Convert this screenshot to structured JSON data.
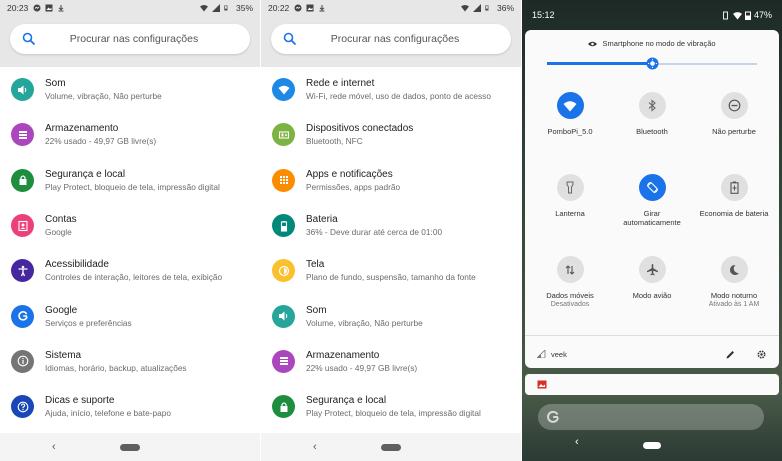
{
  "left_panel": {
    "status": {
      "time": "20:23",
      "battery": "35%"
    },
    "search_placeholder": "Procurar nas configurações",
    "items": [
      {
        "title": "Som",
        "subtitle": "Volume, vibração, Não perturbe",
        "icon": "volume-icon",
        "color": "#26a69a"
      },
      {
        "title": "Armazenamento",
        "subtitle": "22% usado - 49,97 GB livre(s)",
        "icon": "storage-icon",
        "color": "#ab47bc"
      },
      {
        "title": "Segurança e local",
        "subtitle": "Play Protect, bloqueio de tela, impressão digital",
        "icon": "lock-icon",
        "color": "#1e8e3e"
      },
      {
        "title": "Contas",
        "subtitle": "Google",
        "icon": "account-icon",
        "color": "#ec407a"
      },
      {
        "title": "Acessibilidade",
        "subtitle": "Controles de interação, leitores de tela, exibição",
        "icon": "accessibility-icon",
        "color": "#4527a0"
      },
      {
        "title": "Google",
        "subtitle": "Serviços e preferências",
        "icon": "google-icon",
        "color": "#1a73e8"
      },
      {
        "title": "Sistema",
        "subtitle": "Idiomas, horário, backup, atualizações",
        "icon": "info-icon",
        "color": "#757575"
      },
      {
        "title": "Dicas e suporte",
        "subtitle": "Ajuda, início, telefone e bate-papo",
        "icon": "help-icon",
        "color": "#1a47b8"
      }
    ]
  },
  "middle_panel": {
    "status": {
      "time": "20:22",
      "battery": "36%"
    },
    "search_placeholder": "Procurar nas configurações",
    "items": [
      {
        "title": "Rede e internet",
        "subtitle": "Wi-Fi, rede móvel, uso de dados, ponto de acesso",
        "icon": "wifi-icon",
        "color": "#1e88e5"
      },
      {
        "title": "Dispositivos conectados",
        "subtitle": "Bluetooth, NFC",
        "icon": "devices-icon",
        "color": "#7cb342"
      },
      {
        "title": "Apps e notificações",
        "subtitle": "Permissões, apps padrão",
        "icon": "apps-icon",
        "color": "#fb8c00"
      },
      {
        "title": "Bateria",
        "subtitle": "36% - Deve durar até cerca de 01:00",
        "icon": "battery-icon",
        "color": "#00897b"
      },
      {
        "title": "Tela",
        "subtitle": "Plano de fundo, suspensão, tamanho da fonte",
        "icon": "brightness-icon",
        "color": "#fbc02d"
      },
      {
        "title": "Som",
        "subtitle": "Volume, vibração, Não perturbe",
        "icon": "volume-icon",
        "color": "#26a69a"
      },
      {
        "title": "Armazenamento",
        "subtitle": "22% usado - 49,97 GB livre(s)",
        "icon": "storage-icon",
        "color": "#ab47bc"
      },
      {
        "title": "Segurança e local",
        "subtitle": "Play Protect, bloqueio de tela, impressão digital",
        "icon": "lock-icon",
        "color": "#1e8e3e"
      }
    ]
  },
  "quick_settings": {
    "time": "15:12",
    "battery": "47%",
    "ringer_mode": "Smartphone no modo de vibração",
    "volume_level": 0.5,
    "tiles": [
      {
        "label": "PomboPi_5.0",
        "sub": "",
        "icon": "wifi-icon",
        "active": true
      },
      {
        "label": "Bluetooth",
        "sub": "",
        "icon": "bluetooth-icon",
        "active": false
      },
      {
        "label": "Não perturbe",
        "sub": "",
        "icon": "dnd-icon",
        "active": false
      },
      {
        "label": "Lanterna",
        "sub": "",
        "icon": "flashlight-icon",
        "active": false
      },
      {
        "label": "Girar automaticamente",
        "sub": "",
        "icon": "rotate-icon",
        "active": true
      },
      {
        "label": "Economia de bateria",
        "sub": "",
        "icon": "battery-saver-icon",
        "active": false
      },
      {
        "label": "Dados móveis",
        "sub": "Desativados",
        "icon": "mobile-data-icon",
        "active": false
      },
      {
        "label": "Modo avião",
        "sub": "",
        "icon": "airplane-icon",
        "active": false
      },
      {
        "label": "Modo noturno",
        "sub": "Ativado às 1 AM",
        "icon": "moon-icon",
        "active": false
      }
    ],
    "network_name": "veek",
    "accent": "#1a73e8"
  }
}
